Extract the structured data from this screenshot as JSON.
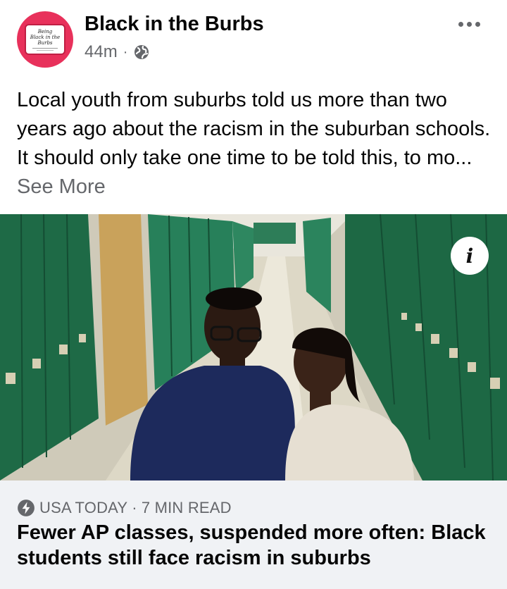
{
  "post": {
    "page_name": "Black in the Burbs",
    "time": "44m",
    "separator": "·",
    "privacy_icon": "globe-icon",
    "more_icon": "more-options-icon",
    "text": "Local youth from suburbs told us more than two years ago about the racism in the suburban schools. It should only take one time to be told this, to mo...",
    "see_more": "See More"
  },
  "avatar": {
    "logo_line1": "Being",
    "logo_line2": "Black in the",
    "logo_line3": "Burbs"
  },
  "link": {
    "image_description_icon": "info-icon",
    "info_label": "i",
    "source_icon": "lightning-bolt-icon",
    "source": "USA TODAY",
    "separator": "·",
    "read_time": "7 MIN READ",
    "headline": "Fewer AP classes, suspended more often: Black students still face racism in suburbs"
  },
  "colors": {
    "brand_pink": "#e8315b",
    "meta_gray": "#65676b",
    "footer_bg": "#f0f2f5",
    "locker_green": "#1f6b47"
  }
}
